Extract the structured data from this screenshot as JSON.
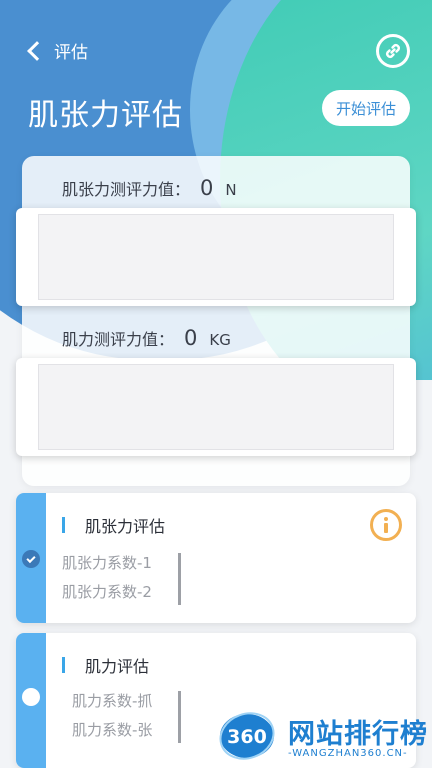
{
  "header": {
    "back_label": "评估",
    "title": "肌张力评估",
    "start_button": "开始评估"
  },
  "tension_measure": {
    "label": "肌张力测评力值：",
    "value": "0",
    "unit": "N"
  },
  "strength_measure": {
    "label": "肌力测评力值：",
    "value": "0",
    "unit": "KG"
  },
  "eval_items": [
    {
      "title": "肌张力评估",
      "selected": true,
      "coeffs": [
        "肌张力系数-1",
        "肌张力系数-2"
      ]
    },
    {
      "title": "肌力评估",
      "selected": false,
      "coeffs": [
        "肌力系数-抓",
        "肌力系数-张"
      ]
    }
  ],
  "watermark": {
    "logo_text": "360",
    "name": "网站排行榜",
    "domain": "-WANGZHAN360.CN-"
  },
  "colors": {
    "header_blue": "#4a8fd0",
    "header_teal": "#3ccab3",
    "stripe": "#5ab1f0",
    "info_orange": "#f2b052",
    "accent": "#3b8fd6"
  }
}
